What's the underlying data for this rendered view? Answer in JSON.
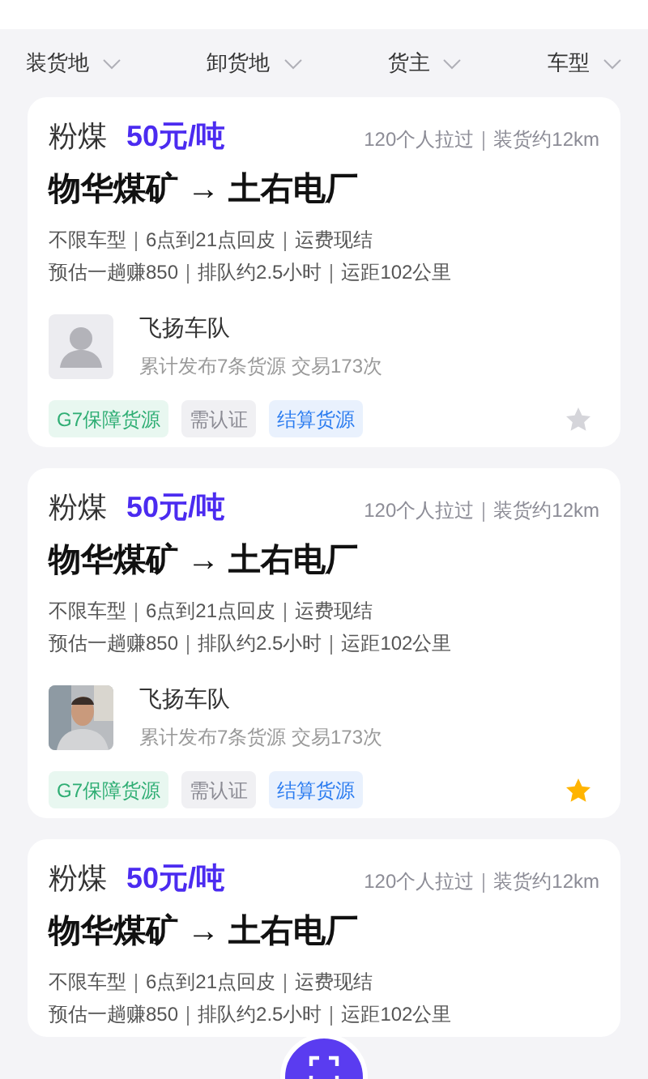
{
  "filters": [
    {
      "label": "装货地"
    },
    {
      "label": "卸货地"
    },
    {
      "label": "货主"
    },
    {
      "label": "车型"
    }
  ],
  "cards": [
    {
      "cargo": "粉煤",
      "price": "50元/吨",
      "stats": "120个人拉过｜装货约12km",
      "route": "物华煤矿 → 土右电厂",
      "details": [
        "不限车型｜6点到21点回皮｜运费现结",
        "预估一趟赚850｜排队约2.5小时｜运距102公里"
      ],
      "owner": {
        "name": "飞扬车队",
        "summary": "累计发布7条货源 交易173次",
        "avatar": {
          "kind": "placeholder"
        }
      },
      "tags": [
        {
          "label": "G7保障货源",
          "kind": "guarantee"
        },
        {
          "label": "需认证",
          "kind": "neutral"
        },
        {
          "label": "结算货源",
          "kind": "settle"
        }
      ],
      "favorited": false
    },
    {
      "cargo": "粉煤",
      "price": "50元/吨",
      "stats": "120个人拉过｜装货约12km",
      "route": "物华煤矿 → 土右电厂",
      "details": [
        "不限车型｜6点到21点回皮｜运费现结",
        "预估一趟赚850｜排队约2.5小时｜运距102公里"
      ],
      "owner": {
        "name": "飞扬车队",
        "summary": "累计发布7条货源 交易173次"
      },
      "tags": [
        {
          "label": "G7保障货源",
          "kind": "guarantee"
        },
        {
          "label": "需认证",
          "kind": "neutral"
        },
        {
          "label": "结算货源",
          "kind": "settle"
        }
      ],
      "favorited": true
    },
    {
      "cargo": "粉煤",
      "price": "50元/吨",
      "stats": "120个人拉过｜装货约12km",
      "route": "物华煤矿 → 土右电厂",
      "details": [
        "不限车型｜6点到21点回皮｜运费现结",
        "预估一趟赚850｜排队约2.5小时｜运距102公里"
      ]
    }
  ]
}
